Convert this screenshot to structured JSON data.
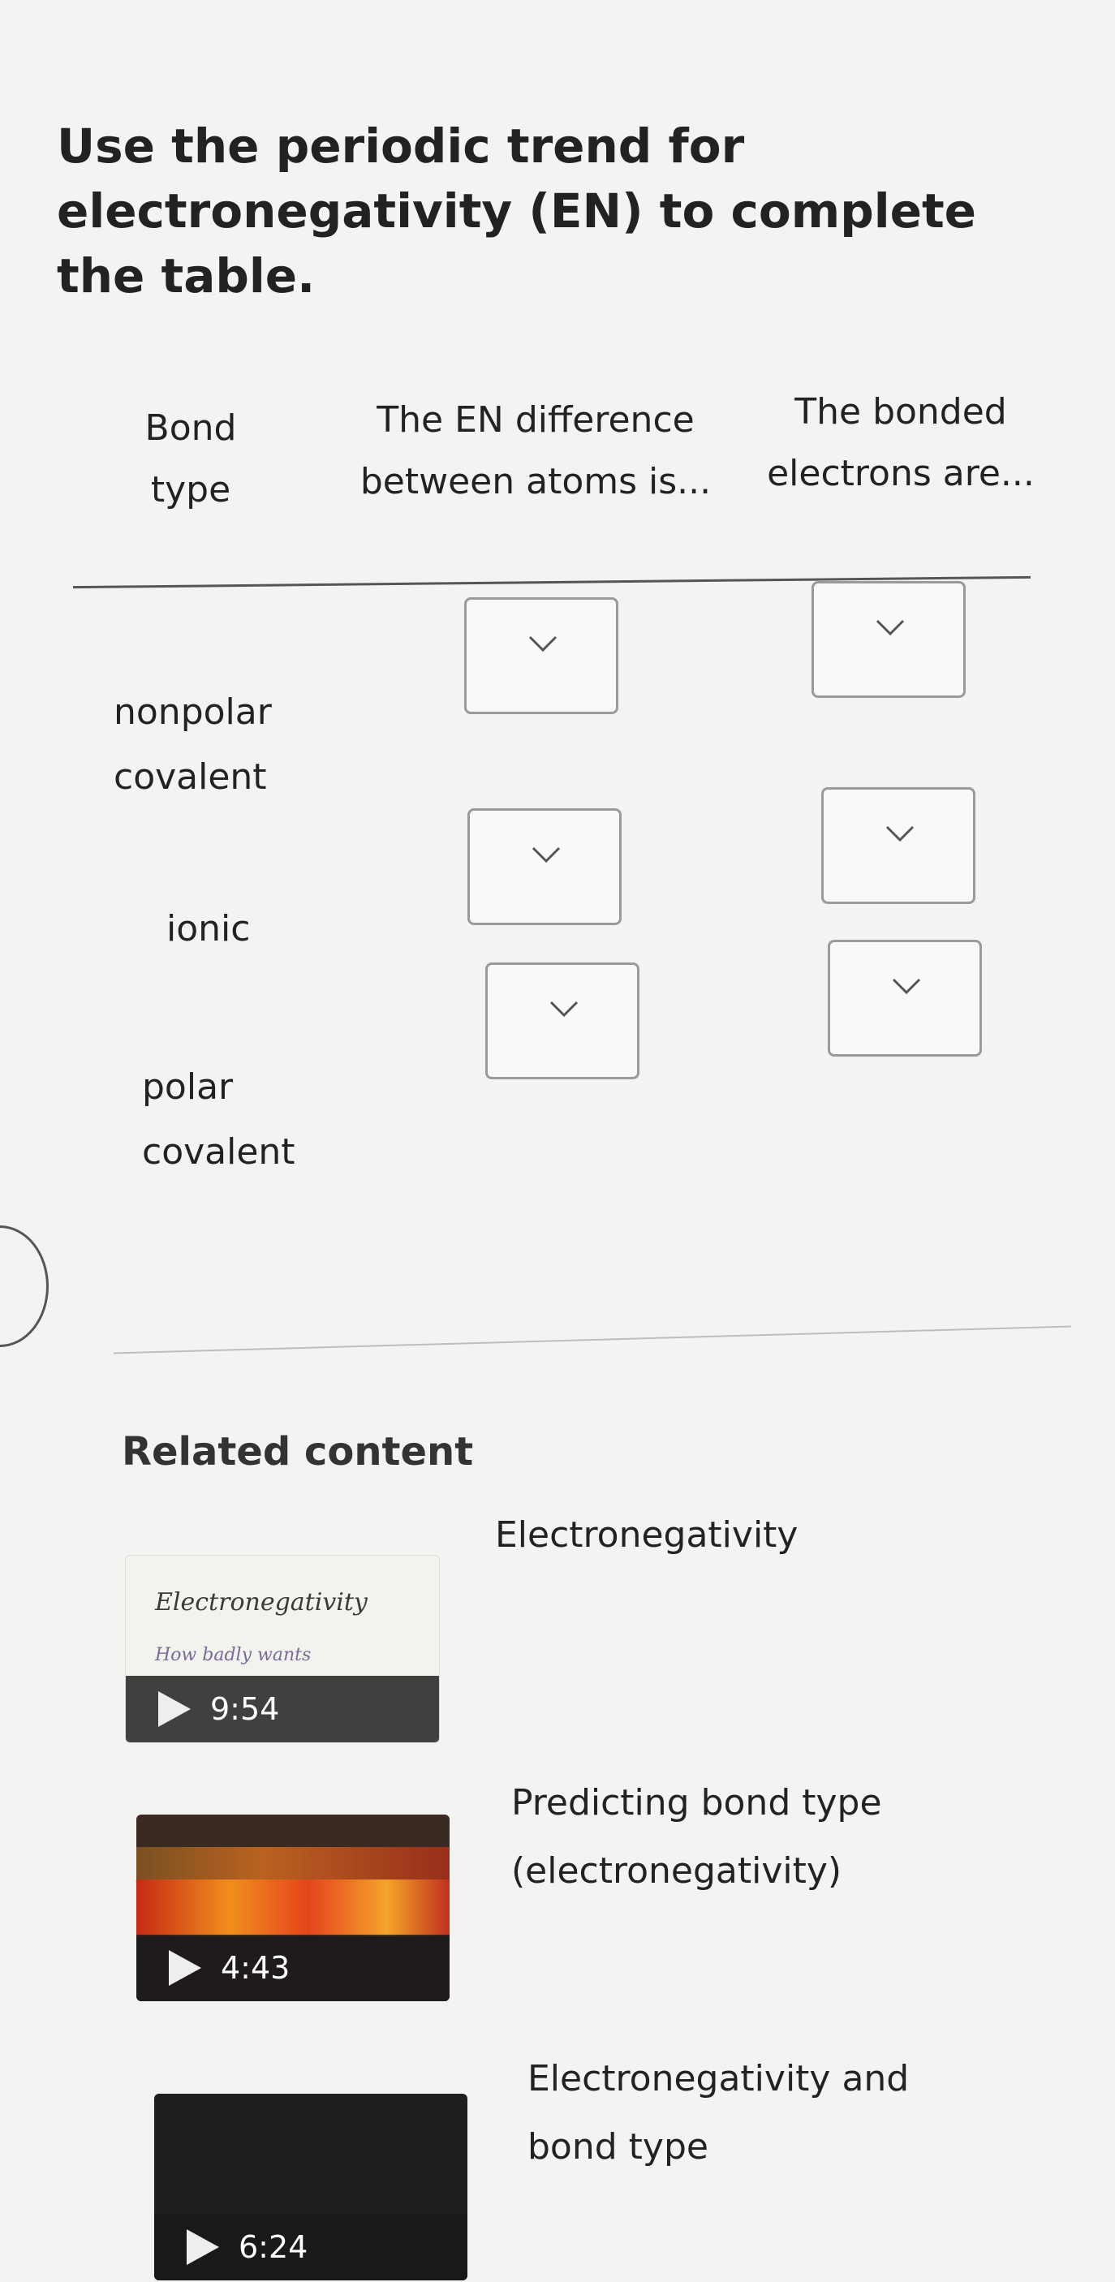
{
  "question": "Use the periodic trend for electronegativity (EN) to complete the table.",
  "table": {
    "headers": {
      "bond_type": "Bond type",
      "en_difference": "The EN difference between atoms is...",
      "bonded_electrons": "The bonded electrons are..."
    },
    "rows": [
      {
        "label": "nonpolar covalent",
        "en_difference_value": "",
        "electrons_value": ""
      },
      {
        "label": "ionic",
        "en_difference_value": "",
        "electrons_value": ""
      },
      {
        "label": "polar covalent",
        "en_difference_value": "",
        "electrons_value": ""
      }
    ]
  },
  "related": {
    "title": "Related content",
    "videos": [
      {
        "title": "Electronegativity",
        "duration": "9:54",
        "thumb_text_1": "Electronegativity",
        "thumb_text_2": "How badly wants"
      },
      {
        "title": "Predicting bond type (electronegativity)",
        "duration": "4:43"
      },
      {
        "title": "Electronegativity and bond type",
        "duration": "6:24"
      }
    ]
  },
  "icons": {
    "dropdown": "chevron-down-icon",
    "play": "play-icon"
  }
}
